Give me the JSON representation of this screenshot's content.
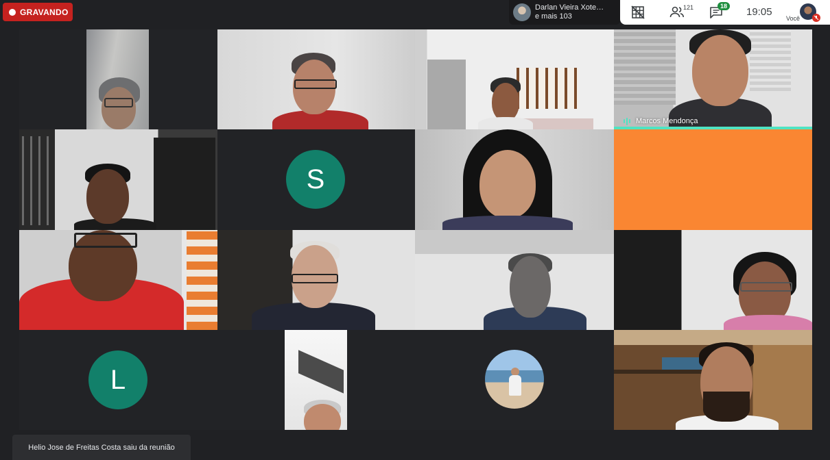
{
  "recording": {
    "label": "GRAVANDO"
  },
  "presenter": {
    "line1": "Darlan Vieira Xote…",
    "line2": "e mais 103"
  },
  "topbar": {
    "participants_count": "121",
    "chat_count": "18",
    "time": "19:05",
    "you_label": "Você"
  },
  "tiles": {
    "marcos_name": "Marcos Mendonça",
    "s_initial": "S",
    "l_initial": "L"
  },
  "toast": {
    "message": "Helio Jose de Freitas Costa saiu da reunião"
  },
  "colors": {
    "recording_red": "#c5221f",
    "speaking_accent": "#4fe3c2",
    "avatar_teal": "#12806a",
    "orange_tile": "#fa8632",
    "badge_green": "#1e8e3e"
  },
  "icons": {
    "layout": "grid-off-icon",
    "participants": "people-icon",
    "chat": "chat-icon",
    "mic": "mic-off-icon",
    "speaking": "audio-bars-icon"
  }
}
